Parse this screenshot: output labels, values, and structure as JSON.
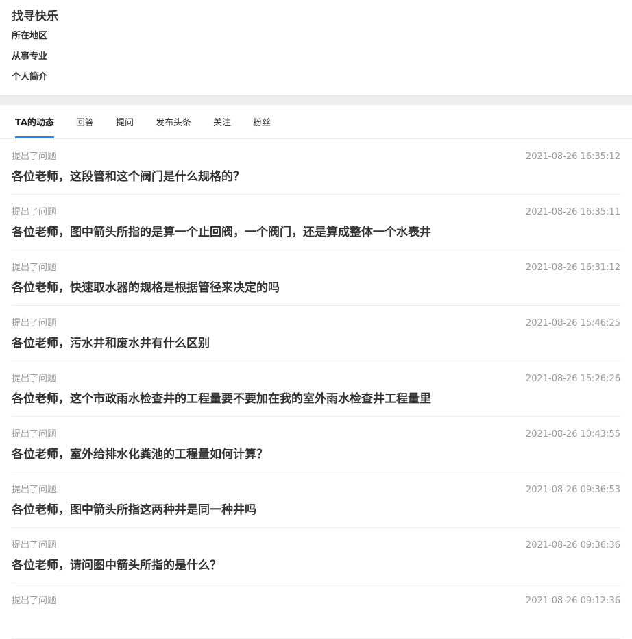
{
  "profile": {
    "username": "找寻快乐",
    "region_label": "所在地区",
    "profession_label": "从事专业",
    "bio_label": "个人简介"
  },
  "tabs": [
    {
      "label": "TA的动态",
      "active": true
    },
    {
      "label": "回答",
      "active": false
    },
    {
      "label": "提问",
      "active": false
    },
    {
      "label": "发布头条",
      "active": false
    },
    {
      "label": "关注",
      "active": false
    },
    {
      "label": "粉丝",
      "active": false
    }
  ],
  "colors": {
    "accent": "#1e88e5",
    "muted_text": "#999999",
    "title_text": "#333333"
  },
  "feed": [
    {
      "action": "提出了问题",
      "time": "2021-08-26 16:35:12",
      "title": "各位老师，这段管和这个阀门是什么规格的？"
    },
    {
      "action": "提出了问题",
      "time": "2021-08-26 16:35:11",
      "title": "各位老师，图中箭头所指的是算一个止回阀，一个阀门，还是算成整体一个水表井"
    },
    {
      "action": "提出了问题",
      "time": "2021-08-26 16:31:12",
      "title": "各位老师，快速取水器的规格是根据管径来决定的吗"
    },
    {
      "action": "提出了问题",
      "time": "2021-08-26 15:46:25",
      "title": "各位老师，污水井和废水井有什么区别"
    },
    {
      "action": "提出了问题",
      "time": "2021-08-26 15:26:26",
      "title": "各位老师，这个市政雨水检查井的工程量要不要加在我的室外雨水检查井工程量里"
    },
    {
      "action": "提出了问题",
      "time": "2021-08-26 10:43:55",
      "title": "各位老师，室外给排水化粪池的工程量如何计算？"
    },
    {
      "action": "提出了问题",
      "time": "2021-08-26 09:36:53",
      "title": "各位老师，图中箭头所指这两种井是同一种井吗"
    },
    {
      "action": "提出了问题",
      "time": "2021-08-26 09:36:36",
      "title": "各位老师，请问图中箭头所指的是什么？"
    },
    {
      "action": "提出了问题",
      "time": "2021-08-26 09:12:36",
      "title": ""
    }
  ]
}
